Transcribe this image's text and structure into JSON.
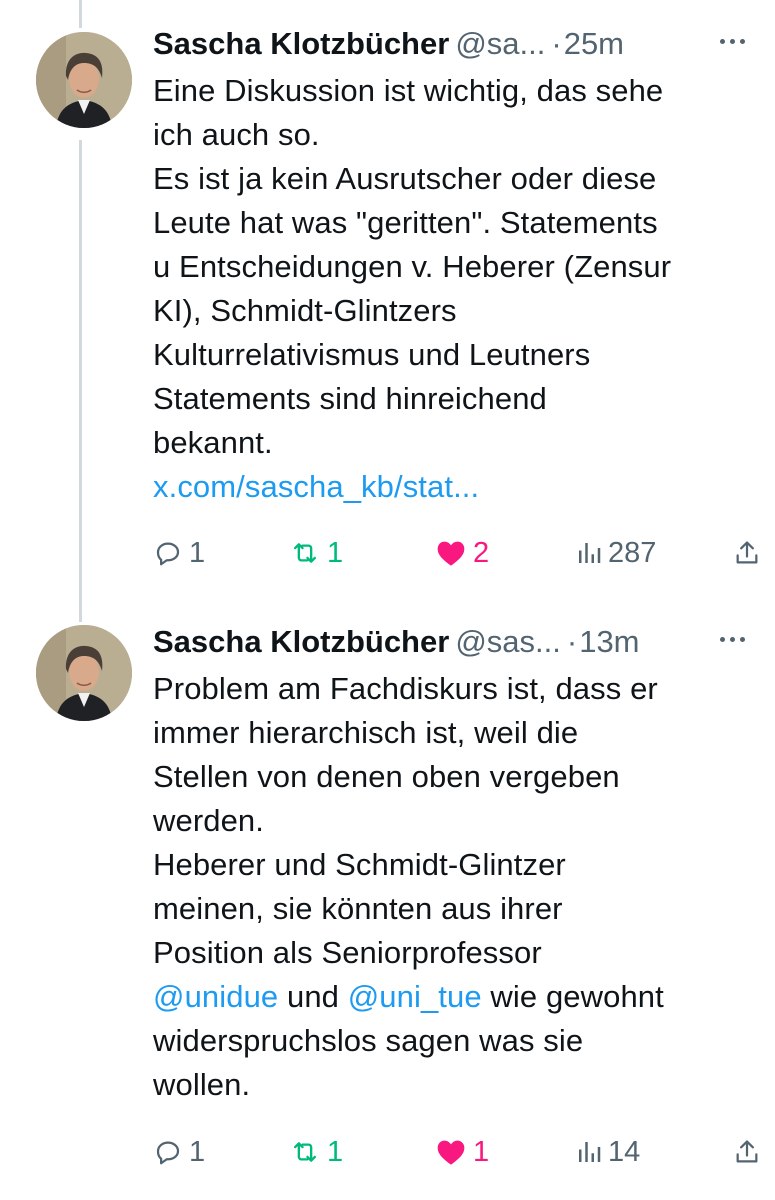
{
  "tweets": [
    {
      "author": "Sascha Klotzbücher",
      "handle": "@sa...",
      "time": "25m",
      "body_lines": [
        "Eine Diskussion ist wichtig, das sehe",
        "ich auch so.",
        "Es ist ja kein Ausrutscher oder diese",
        "Leute hat was \"geritten\". Statements",
        "u Entscheidungen v. Heberer (Zensur",
        "KI), Schmidt-Glintzers",
        "Kulturrelativismus und Leutners",
        "Statements sind hinreichend",
        "bekannt."
      ],
      "link": "x.com/sascha_kb/stat...",
      "replies": "1",
      "retweets": "1",
      "likes": "2",
      "views": "287"
    },
    {
      "author": "Sascha Klotzbücher",
      "handle": "@sas...",
      "time": "13m",
      "body_lines": [
        "Problem am Fachdiskurs ist, dass er",
        "immer hierarchisch ist, weil die",
        "Stellen von denen oben vergeben",
        "werden.",
        "Heberer und Schmidt-Glintzer",
        "meinen, sie könnten aus ihrer",
        "Position als Seniorprofessor"
      ],
      "mention_line": {
        "mention1": "@unidue",
        "text1": " und ",
        "mention2": "@uni_tue",
        "text2": " wie gewohnt"
      },
      "body_lines_after": [
        "widerspruchslos sagen was sie",
        "wollen."
      ],
      "replies": "1",
      "retweets": "1",
      "likes": "1",
      "views": "14"
    }
  ],
  "icons": {
    "reply": "reply-icon",
    "retweet": "retweet-icon",
    "like": "heart-icon",
    "views": "views-icon",
    "share": "share-icon",
    "more": "more-icon"
  },
  "colors": {
    "text": "#0f1419",
    "secondary": "#536471",
    "link": "#1d9bf0",
    "retweet": "#00ba7c",
    "like": "#f91880",
    "thread_line": "#cfd9de"
  }
}
